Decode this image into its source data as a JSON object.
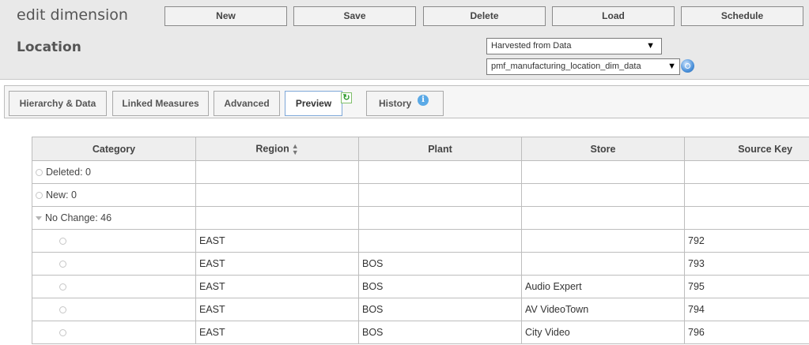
{
  "header": {
    "app_title": "edit dimension",
    "dimension_name": "Location"
  },
  "toolbar": {
    "new_label": "New",
    "save_label": "Save",
    "delete_label": "Delete",
    "load_label": "Load",
    "schedule_label": "Schedule"
  },
  "source": {
    "type_value": "Harvested from Data",
    "table_value": "pmf_manufacturing_location_dim_data"
  },
  "tabs": {
    "hierarchy": "Hierarchy & Data",
    "linked": "Linked Measures",
    "advanced": "Advanced",
    "preview": "Preview",
    "history": "History"
  },
  "grid": {
    "columns": {
      "category": "Category",
      "region": "Region",
      "plant": "Plant",
      "store": "Store",
      "source_key": "Source Key"
    },
    "rows": [
      {
        "category": "Deleted: 0",
        "region": "",
        "plant": "",
        "store": "",
        "source_key": ""
      },
      {
        "category": "New: 0",
        "region": "",
        "plant": "",
        "store": "",
        "source_key": ""
      },
      {
        "category": "No Change: 46",
        "region": "",
        "plant": "",
        "store": "",
        "source_key": ""
      },
      {
        "category": "",
        "region": "EAST",
        "plant": "",
        "store": "",
        "source_key": "792"
      },
      {
        "category": "",
        "region": "EAST",
        "plant": "BOS",
        "store": "",
        "source_key": "793"
      },
      {
        "category": "",
        "region": "EAST",
        "plant": "BOS",
        "store": "Audio Expert",
        "source_key": "795"
      },
      {
        "category": "",
        "region": "EAST",
        "plant": "BOS",
        "store": "AV VideoTown",
        "source_key": "794"
      },
      {
        "category": "",
        "region": "EAST",
        "plant": "BOS",
        "store": "City Video",
        "source_key": "796"
      }
    ]
  }
}
